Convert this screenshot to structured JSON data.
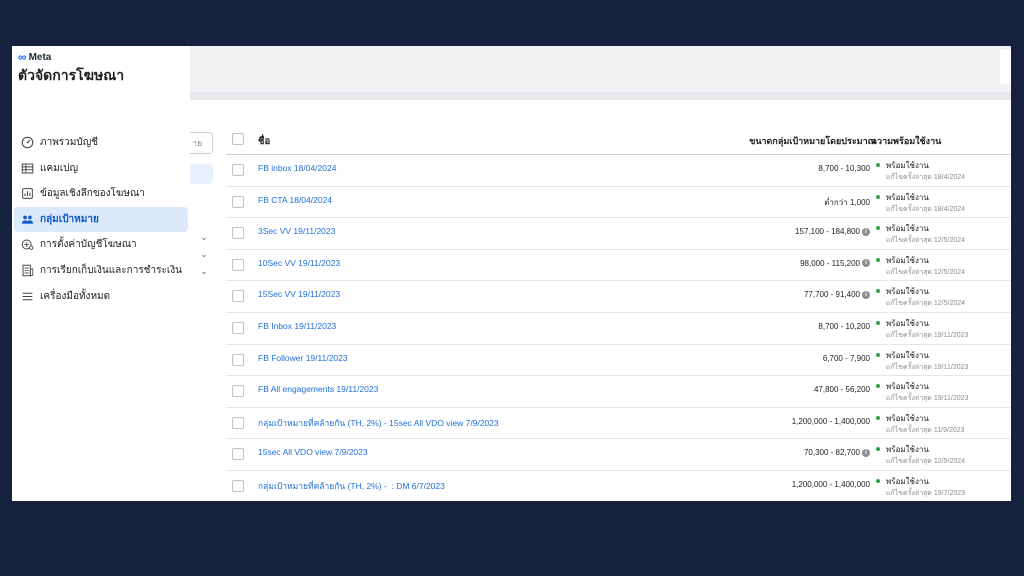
{
  "brand": {
    "logo_text": "Meta",
    "app_title": "ตัวจัดการโฆษณา"
  },
  "sidebar": {
    "items": [
      {
        "label": "ภาพรวมบัญชี",
        "icon": "gauge-icon",
        "active": false,
        "chevron": false
      },
      {
        "label": "แคมเปญ",
        "icon": "table-icon",
        "active": false,
        "chevron": false
      },
      {
        "label": "ข้อมูลเชิงลึกของโฆษณา",
        "icon": "insights-icon",
        "active": false,
        "chevron": false
      },
      {
        "label": "กลุ่มเป้าหมาย",
        "icon": "audience-icon",
        "active": true,
        "chevron": false
      },
      {
        "label": "การตั้งค่าบัญชีโฆษณา",
        "icon": "settings-icon",
        "active": false,
        "chevron": true
      },
      {
        "label": "การเรียกเก็บเงินและการชำระเงิน",
        "icon": "billing-icon",
        "active": false,
        "chevron": true
      },
      {
        "label": "เครื่องมือทั้งหมด",
        "icon": "menu-icon",
        "active": false,
        "chevron": true
      }
    ]
  },
  "search": {
    "stub_text": "าย"
  },
  "table": {
    "headers": {
      "name": "ชื่อ",
      "size": "ขนาดกลุ่มเป้าหมายโดยประมาณ",
      "status": "ความพร้อมใช้งาน"
    },
    "rows": [
      {
        "name": "FB inbox 18/04/2024",
        "size": "8,700 - 10,300",
        "info": false,
        "status": "พร้อมใช้งาน",
        "updated": "แก้ไขครั้งล่าสุด 18/4/2024"
      },
      {
        "name": "FB CTA 18/04/2024",
        "size": "ต่ำกว่า 1,000",
        "info": false,
        "status": "พร้อมใช้งาน",
        "updated": "แก้ไขครั้งล่าสุด 18/4/2024"
      },
      {
        "name": "3Sec VV 19/11/2023",
        "size": "157,100 - 184,800",
        "info": true,
        "status": "พร้อมใช้งาน",
        "updated": "แก้ไขครั้งล่าสุด 12/5/2024"
      },
      {
        "name": "10Sec VV 19/11/2023",
        "size": "98,000 - 115,200",
        "info": true,
        "status": "พร้อมใช้งาน",
        "updated": "แก้ไขครั้งล่าสุด 12/5/2024"
      },
      {
        "name": "15Sec VV 19/11/2023",
        "size": "77,700 - 91,400",
        "info": true,
        "status": "พร้อมใช้งาน",
        "updated": "แก้ไขครั้งล่าสุด 12/5/2024"
      },
      {
        "name": "FB Inbox 19/11/2023",
        "size": "8,700 - 10,200",
        "info": false,
        "status": "พร้อมใช้งาน",
        "updated": "แก้ไขครั้งล่าสุด 19/11/2023"
      },
      {
        "name": "FB Follower 19/11/2023",
        "size": "6,700 - 7,900",
        "info": false,
        "status": "พร้อมใช้งาน",
        "updated": "แก้ไขครั้งล่าสุด 19/11/2023"
      },
      {
        "name": "FB All engagements 19/11/2023",
        "size": "47,800 - 56,200",
        "info": false,
        "status": "พร้อมใช้งาน",
        "updated": "แก้ไขครั้งล่าสุด 19/11/2023"
      },
      {
        "name": "กลุ่มเป้าหมายที่คล้ายกัน (TH, 2%) - 15sec All VDO view 7/9/2023",
        "size": "1,200,000 - 1,400,000",
        "info": false,
        "status": "พร้อมใช้งาน",
        "updated": "แก้ไขครั้งล่าสุด 11/9/2023"
      },
      {
        "name": "15sec All VDO view 7/9/2023",
        "size": "70,300 - 82,700",
        "info": true,
        "status": "พร้อมใช้งาน",
        "updated": "แก้ไขครั้งล่าสุด 12/5/2024"
      },
      {
        "name": "กลุ่มเป้าหมายที่คล้ายกัน (TH, 2%) - ‍                          : DM 6/7/2023",
        "size": "1,200,000 - 1,400,000",
        "info": false,
        "status": "พร้อมใช้งาน",
        "updated": "แก้ไขครั้งล่าสุด 19/7/2023"
      }
    ]
  },
  "colors": {
    "background": "#16213e",
    "link": "#216fdb",
    "active_nav": "#dce9fb",
    "status_green": "#31a24c"
  }
}
